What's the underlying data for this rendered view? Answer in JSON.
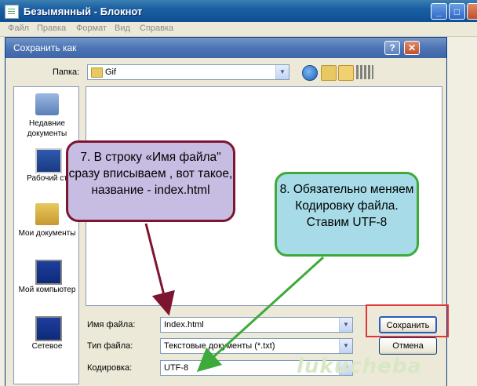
{
  "notepad": {
    "title": "Безымянный - Блокнот",
    "menu": [
      "Файл",
      "Правка",
      "Формат",
      "Вид",
      "Справка"
    ],
    "controls": {
      "minimize": "_",
      "restore": "□",
      "close": "✕"
    }
  },
  "dialog": {
    "title": "Сохранить как",
    "help": "?",
    "close": "✕",
    "folder_label": "Папка:",
    "folder_value": "Gif",
    "toolbar_icons": [
      "back-icon",
      "up-folder-icon",
      "new-folder-icon",
      "view-menu-icon"
    ],
    "places": [
      {
        "label": "Недавние документы",
        "icon": "recent-documents-icon"
      },
      {
        "label": "Рабочий ст",
        "icon": "desktop-icon"
      },
      {
        "label": "Мои документы",
        "icon": "my-documents-icon"
      },
      {
        "label": "Мой компьютер",
        "icon": "my-computer-icon"
      },
      {
        "label": "Сетевое",
        "icon": "network-icon"
      }
    ],
    "filename_label": "Имя файла:",
    "filename_value": "Index.html",
    "filetype_label": "Тип файла:",
    "filetype_value": "Текстовые документы (*.txt)",
    "encoding_label": "Кодировка:",
    "encoding_value": "UTF-8",
    "save_button": "Сохранить",
    "cancel_button": "Отмена"
  },
  "annotations": {
    "step7": "7. В строку «Имя файла\"  сразу вписываем , вот такое, название -  index.html",
    "step8": "8. Обязательно меняем Кодировку файла. Ставим UTF-8",
    "watermark": "lukucheba",
    "colors": {
      "step7_fill": "#c7bde2",
      "step7_border": "#7d1530",
      "step8_fill": "#a6dbe7",
      "step8_border": "#3daa3a",
      "highlight": "#e0363a"
    }
  }
}
